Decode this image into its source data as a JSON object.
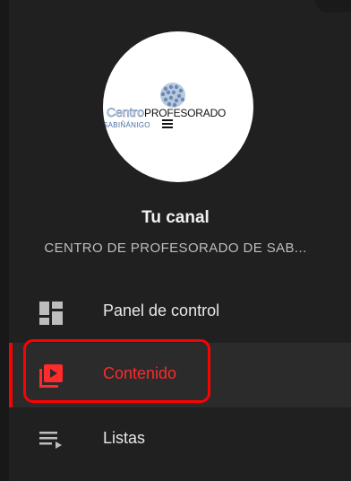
{
  "channel": {
    "title": "Tu canal",
    "name": "CENTRO DE PROFESORADO DE SAB...",
    "logo": {
      "word_centro": "Centro",
      "word_profesorado": "PROFESORADO",
      "word_place": "SABIÑÁNIGO"
    }
  },
  "nav": {
    "items": [
      {
        "label": "Panel de control",
        "icon": "dashboard-icon",
        "active": false
      },
      {
        "label": "Contenido",
        "icon": "content-video-icon",
        "active": true
      },
      {
        "label": "Listas",
        "icon": "playlist-icon",
        "active": false
      }
    ]
  },
  "colors": {
    "background": "#202020",
    "active_row": "#2b2b2b",
    "accent": "#ff0000",
    "text": "#e8e8e8",
    "subtext": "#bdbdbd"
  }
}
